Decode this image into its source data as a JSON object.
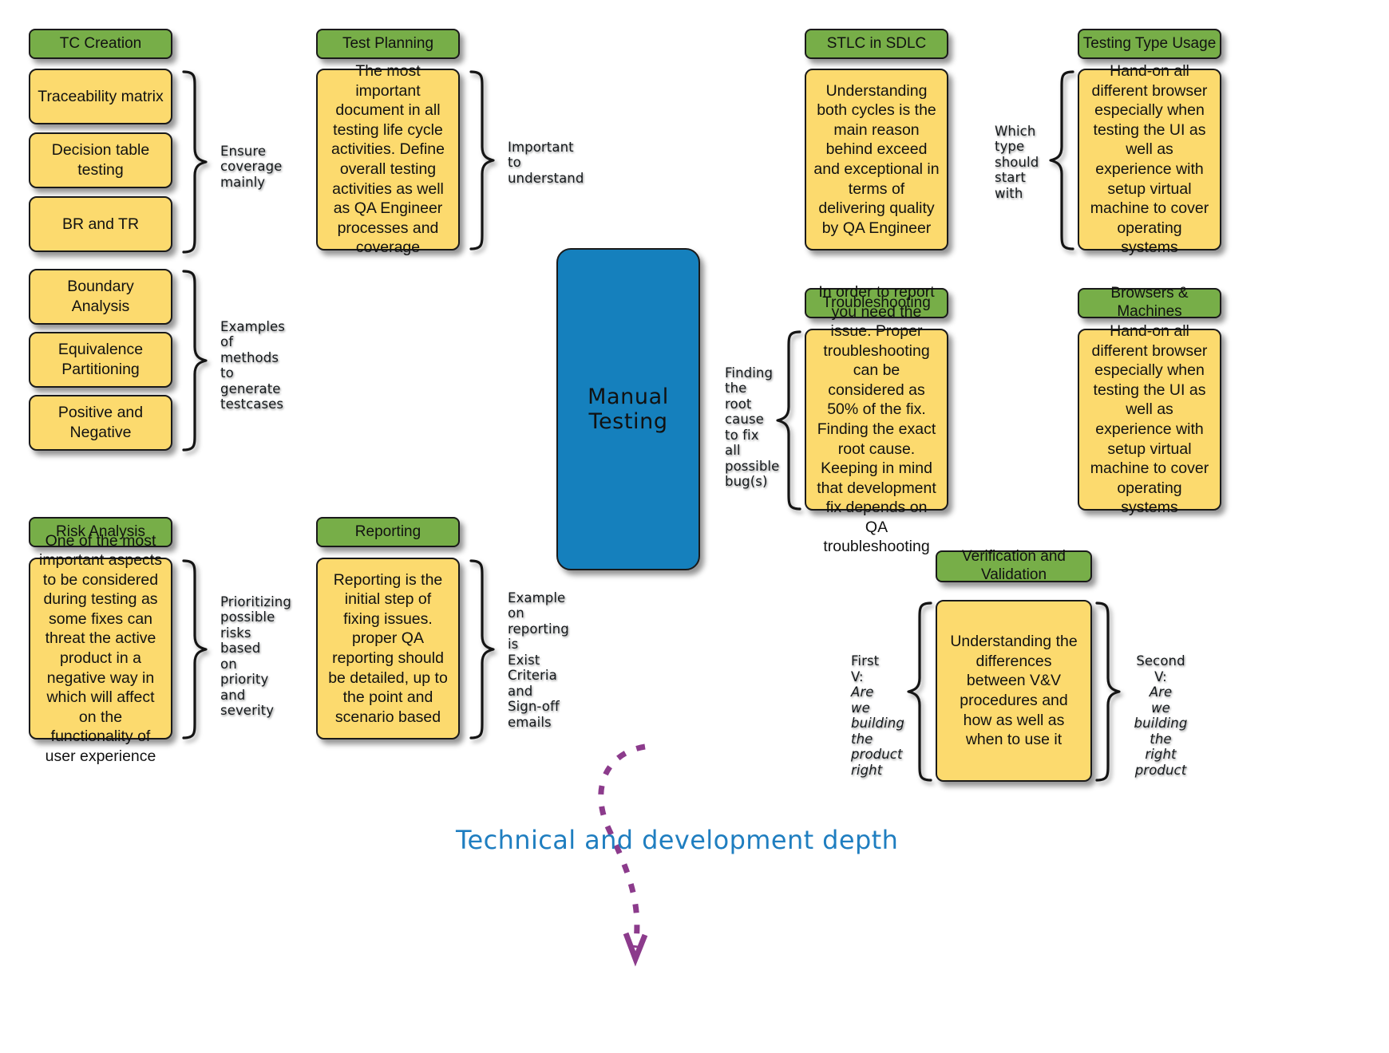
{
  "diagram": {
    "center": {
      "label": "Manual Testing"
    },
    "caption": "Technical and development depth",
    "accent_colors": {
      "header_green": "#77ae48",
      "leaf_yellow": "#fcda6e",
      "center_blue": "#1580bd",
      "caption_blue": "#1f7ec0",
      "arrow_purple": "#8c3b8c",
      "outline": "#1a1a1a"
    },
    "branches": [
      {
        "id": "tc-creation",
        "header": "TC Creation",
        "groups": [
          {
            "items": [
              "Traceability matrix",
              "Decision table testing",
              "BR and TR"
            ],
            "annotation": "Ensure\ncoverage\nmainly"
          },
          {
            "items": [
              "Boundary Analysis",
              "Equivalence\nPartitioning",
              "Positive and Negative"
            ],
            "annotation": "Examples\nof\nmethods\nto\ngenerate\ntestcases"
          }
        ]
      },
      {
        "id": "test-planning",
        "header": "Test Planning",
        "body": "The most important document in all testing life cycle activities. Define overall testing activities as well as QA Engineer processes and coverage",
        "annotation": "Important\nto\nunderstand"
      },
      {
        "id": "risk-analysis",
        "header": "Risk Analysis",
        "body": "One of the most important aspects to be considered during testing as some fixes can threat the active product in a negative way in which will affect on the functionality of user experience",
        "annotation": "Prioritizing\npossible\nrisks\nbased\non\npriority\nand\nseverity"
      },
      {
        "id": "reporting",
        "header": "Reporting",
        "body": "Reporting is the initial step of fixing issues. proper QA reporting should be detailed, up to the point and scenario based",
        "annotation": "Example\non\nreporting\nis\nExist\nCriteria\nand\nSign-off\nemails"
      },
      {
        "id": "stlc-in-sdlc",
        "header": "STLC in SDLC",
        "body": "Understanding both cycles is the main reason behind exceed and exceptional in terms of delivering quality by QA Engineer"
      },
      {
        "id": "testing-type-usage",
        "header": "Testing Type Usage",
        "body": "Hand-on all different browser especially when testing the UI as well as experience with setup virtual machine to cover operating systems",
        "annotation": "Which\ntype\nshould\nstart\nwith"
      },
      {
        "id": "troubleshooting",
        "header": "Troubleshooting",
        "body": "In order to report you need the issue. Proper troubleshooting can be considered as 50% of the fix. Finding the exact root cause. Keeping in mind that development fix depends on QA troubleshooting",
        "annotation": "Finding\nthe\nroot\ncause\nto fix\nall\npossible\nbug(s)"
      },
      {
        "id": "browsers-and-machines",
        "header": "Browsers & Machines",
        "body": "Hand-on all different browser especially when testing the UI as well as experience with setup virtual machine to cover operating systems"
      },
      {
        "id": "verification-and-validation",
        "header": "Verification and Validation",
        "body": "Understanding the differences between V&V procedures and how as well as when to use it",
        "annotation_left_title": "First\nV:",
        "annotation_left_question": "Are\nwe\nbuilding\nthe\nproduct\nright",
        "annotation_right_title": "Second\nV:",
        "annotation_right_question": "Are\nwe\nbuilding\nthe\nright\nproduct"
      }
    ]
  }
}
